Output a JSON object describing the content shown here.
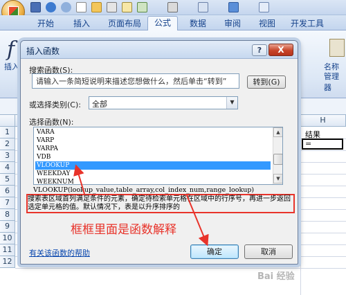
{
  "ribbon": {
    "tabs": [
      "开始",
      "插入",
      "页面布局",
      "公式",
      "数据",
      "审阅",
      "视图",
      "开发工具"
    ],
    "active_tab": "公式",
    "insert_function_label": "插入",
    "name_manager_label_1": "名称",
    "name_manager_label_2": "管理器"
  },
  "sheet": {
    "columns": [
      "H"
    ],
    "rows": [
      "1",
      "2",
      "3",
      "4",
      "5",
      "6",
      "7",
      "8",
      "9",
      "10",
      "11",
      "12"
    ],
    "left_cells": [
      "身",
      "2",
      "A",
      "B",
      "C",
      "D",
      "E"
    ],
    "result_header": "结果",
    "active_cell_value": "="
  },
  "dialog": {
    "title": "插入函数",
    "help_button": "?",
    "close_button": "X",
    "search_label": "搜索函数(S):",
    "search_value": "请输入一条简短说明来描述您想做什么，然后单击“转到”",
    "goto_button": "转到(G)",
    "category_label": "或选择类别(C):",
    "category_value": "全部",
    "function_list_label": "选择函数(N):",
    "functions": [
      "VARA",
      "VARP",
      "VARPA",
      "VDB",
      "VLOOKUP",
      "WEEKDAY",
      "WEEKNUM"
    ],
    "selected_function": "VLOOKUP",
    "signature": "VLOOKUP(lookup_value,table_array,col_index_num,range_lookup)",
    "description": "搜索表区域首列满足条件的元素，确定待检索单元格在区域中的行序号，再进一步返回选定单元格的值。默认情况下，表是以升序排序的",
    "help_link": "有关该函数的帮助",
    "ok_button": "确定",
    "cancel_button": "取消"
  },
  "annotation": {
    "text": "框框里面是函数解释",
    "color": "#e8332a"
  },
  "watermark": "Bai 经验"
}
